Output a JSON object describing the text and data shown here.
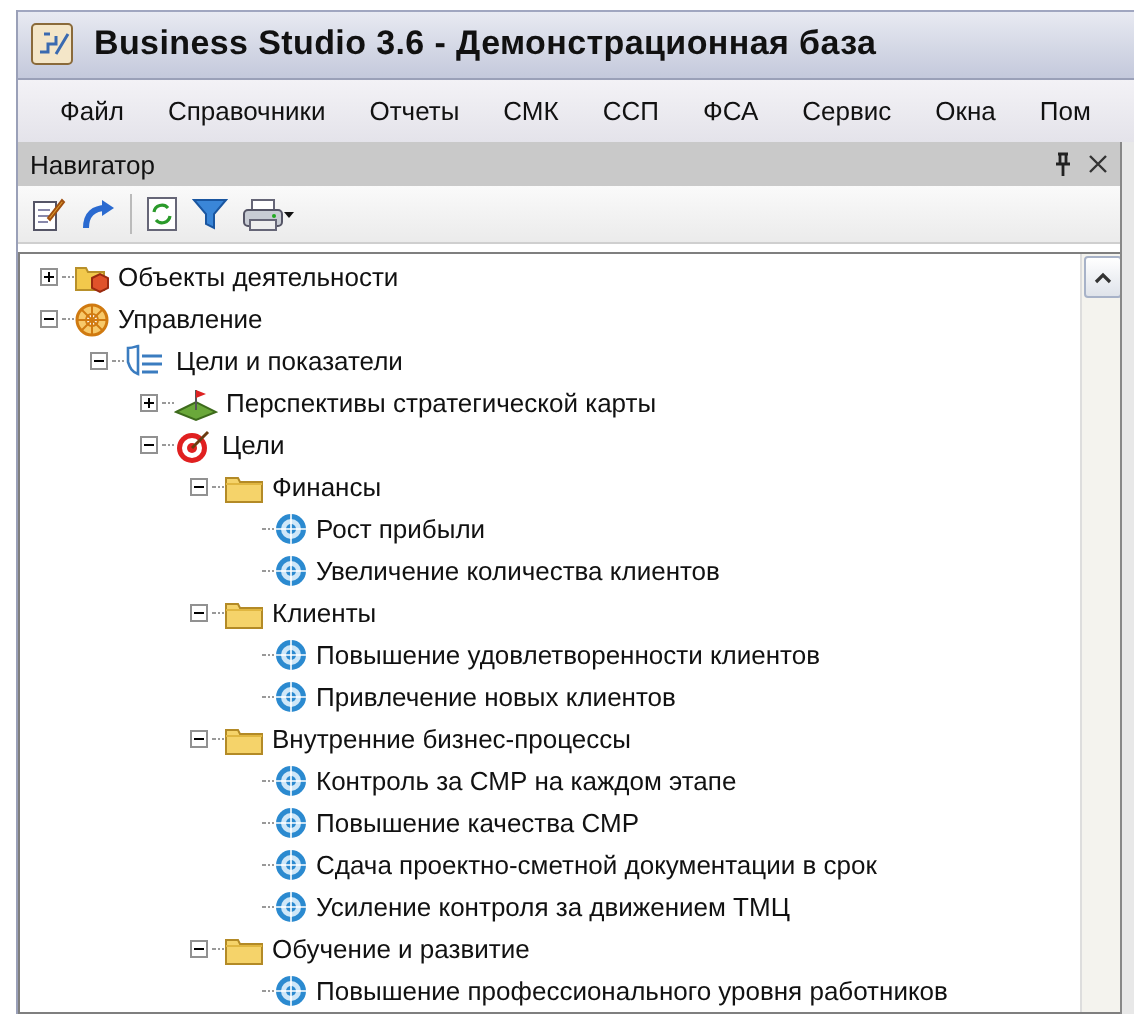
{
  "window": {
    "title": "Business Studio 3.6 - Демонстрационная база"
  },
  "menu": [
    "Файл",
    "Справочники",
    "Отчеты",
    "СМК",
    "ССП",
    "ФСА",
    "Сервис",
    "Окна",
    "Пом"
  ],
  "navigator": {
    "title": "Навигатор"
  },
  "tree": [
    {
      "label": "Объекты деятельности",
      "kind": "objects",
      "expanded": false
    },
    {
      "label": "Управление",
      "kind": "management",
      "expanded": true,
      "children": [
        {
          "label": "Цели и показатели",
          "kind": "bsc",
          "expanded": true,
          "children": [
            {
              "label": "Перспективы стратегической карты",
              "kind": "perspectives",
              "expanded": false
            },
            {
              "label": "Цели",
              "kind": "goals",
              "expanded": true,
              "children": [
                {
                  "label": "Финансы",
                  "kind": "folder",
                  "expanded": true,
                  "children": [
                    {
                      "label": "Рост прибыли",
                      "kind": "goal"
                    },
                    {
                      "label": "Увеличение количества клиентов",
                      "kind": "goal"
                    }
                  ]
                },
                {
                  "label": "Клиенты",
                  "kind": "folder",
                  "expanded": true,
                  "children": [
                    {
                      "label": "Повышение удовлетворенности клиентов",
                      "kind": "goal"
                    },
                    {
                      "label": "Привлечение новых клиентов",
                      "kind": "goal"
                    }
                  ]
                },
                {
                  "label": "Внутренние бизнес-процессы",
                  "kind": "folder",
                  "expanded": true,
                  "children": [
                    {
                      "label": "Контроль за СМР на каждом этапе",
                      "kind": "goal"
                    },
                    {
                      "label": "Повышение качества СМР",
                      "kind": "goal"
                    },
                    {
                      "label": "Сдача проектно-сметной документации в срок",
                      "kind": "goal"
                    },
                    {
                      "label": "Усиление контроля за движением ТМЦ",
                      "kind": "goal"
                    }
                  ]
                },
                {
                  "label": "Обучение и развитие",
                  "kind": "folder",
                  "expanded": true,
                  "children": [
                    {
                      "label": "Повышение профессионального уровня работников",
                      "kind": "goal"
                    }
                  ]
                }
              ]
            }
          ]
        }
      ]
    }
  ]
}
